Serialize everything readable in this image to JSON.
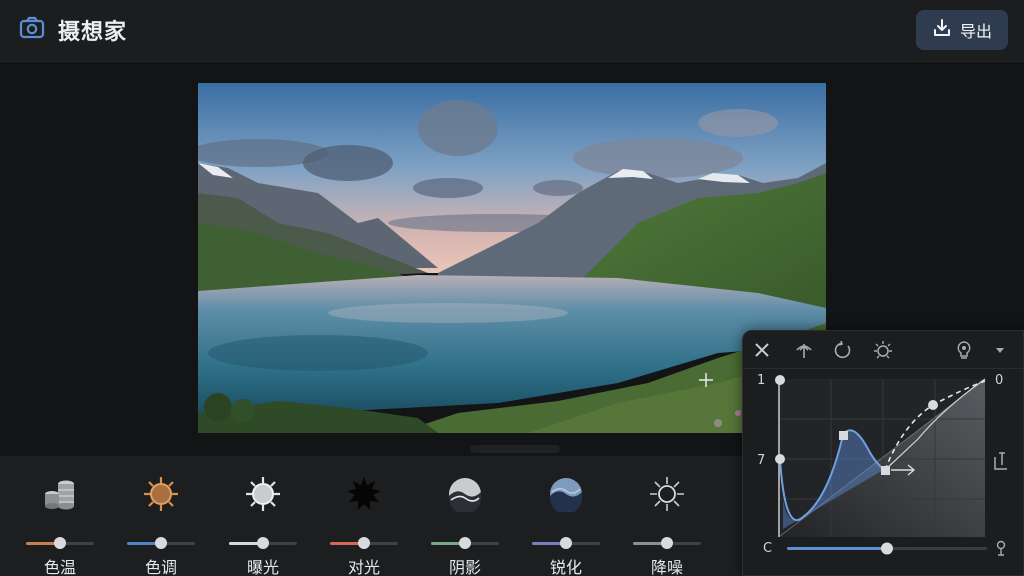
{
  "header": {
    "app_title": "摄想家",
    "export_label": "导出"
  },
  "colors": {
    "accent": "#5b8fd6",
    "header_bg": "#1c1d1f",
    "export_bg": "#2f3c4f"
  },
  "tools": [
    {
      "label": "色温",
      "icon": "temperature-icon",
      "value": 0.5,
      "accent": "#c8804e"
    },
    {
      "label": "色调",
      "icon": "tint-sun-icon",
      "value": 0.5,
      "accent": "#4f84c4"
    },
    {
      "label": "曝光",
      "icon": "exposure-sun-icon",
      "value": 0.5,
      "accent": "#d7d9dc"
    },
    {
      "label": "对光",
      "icon": "contrast-burst-icon",
      "value": 0.5,
      "accent": "#d46a55"
    },
    {
      "label": "阴影",
      "icon": "shadow-wave-icon",
      "value": 0.5,
      "accent": "#76a888"
    },
    {
      "label": "锐化",
      "icon": "sharpen-wave-icon",
      "value": 0.5,
      "accent": "#7a7fc4"
    },
    {
      "label": "降噪",
      "icon": "denoise-sun-icon",
      "value": 0.5,
      "accent": "#8c8f93"
    }
  ],
  "curve_panel": {
    "toolbar": [
      "close-icon",
      "tree-icon",
      "reset-icon",
      "brightness-icon",
      "bulb-icon",
      "dropdown-icon"
    ],
    "left_top_label": "1",
    "left_mid_label": "7",
    "right_top_label": "0",
    "bottom_left_label": "C",
    "bottom_slider_value": 0.5
  }
}
